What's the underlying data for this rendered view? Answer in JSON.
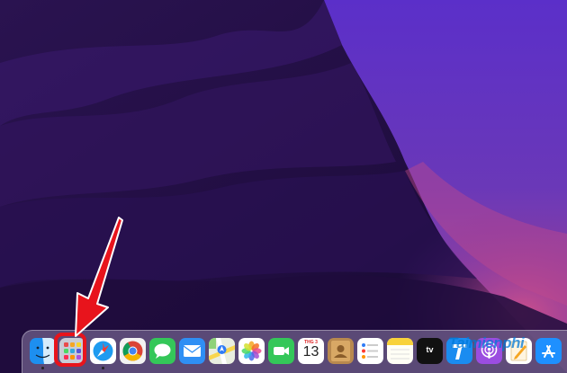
{
  "desktop": {
    "wallpaper": "macOS Monterey purple"
  },
  "dock": {
    "apps": [
      {
        "id": "finder",
        "icon": "finder-icon",
        "running": true
      },
      {
        "id": "launchpad",
        "icon": "launchpad-icon",
        "running": false,
        "highlighted": true
      },
      {
        "id": "safari",
        "icon": "safari-icon",
        "running": true
      },
      {
        "id": "chrome",
        "icon": "chrome-icon",
        "running": false
      },
      {
        "id": "messages",
        "icon": "messages-icon",
        "running": false
      },
      {
        "id": "mail",
        "icon": "mail-icon",
        "running": false
      },
      {
        "id": "maps",
        "icon": "maps-icon",
        "running": false
      },
      {
        "id": "photos",
        "icon": "photos-icon",
        "running": false
      },
      {
        "id": "facetime",
        "icon": "facetime-icon",
        "running": false
      },
      {
        "id": "calendar",
        "icon": "calendar-icon",
        "running": false
      },
      {
        "id": "contacts",
        "icon": "contacts-icon",
        "running": false
      },
      {
        "id": "reminders",
        "icon": "reminders-icon",
        "running": false
      },
      {
        "id": "notes",
        "icon": "notes-icon",
        "running": false
      },
      {
        "id": "tv",
        "icon": "apple-tv-icon",
        "running": false
      },
      {
        "id": "testflight",
        "icon": "testflight-icon",
        "running": false
      },
      {
        "id": "podcasts",
        "icon": "podcasts-icon",
        "running": false
      },
      {
        "id": "pages",
        "icon": "pages-icon",
        "running": false
      },
      {
        "id": "appstore",
        "icon": "app-store-icon",
        "running": false
      }
    ],
    "calendar": {
      "month": "THG 3",
      "day": "13"
    },
    "tv": {
      "label": "tv"
    }
  },
  "annotation": {
    "color": "#e8141c"
  },
  "watermark": {
    "text": "Taimienphi"
  }
}
